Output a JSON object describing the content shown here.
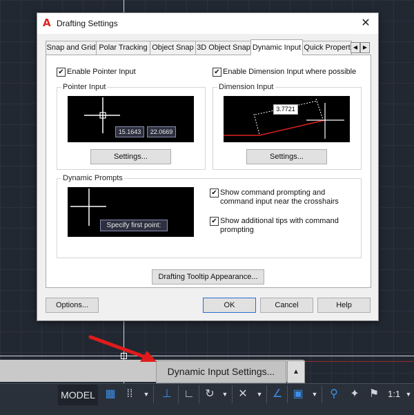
{
  "dialog": {
    "title": "Drafting Settings",
    "close_symbol": "✕",
    "tabs": [
      {
        "label": "Snap and Grid"
      },
      {
        "label": "Polar Tracking"
      },
      {
        "label": "Object Snap"
      },
      {
        "label": "3D Object Snap"
      },
      {
        "label": "Dynamic Input",
        "active": true
      },
      {
        "label": "Quick Propert"
      }
    ],
    "tab_scroll_left": "◀",
    "tab_scroll_right": "▶",
    "enable_pointer_input": {
      "label": "Enable Pointer Input",
      "checked": true
    },
    "enable_dimension_input": {
      "label": "Enable Dimension Input where possible",
      "checked": true
    },
    "pointer_input": {
      "title": "Pointer Input",
      "preview_values": [
        "15.1643",
        "22.0669"
      ],
      "settings_label": "Settings..."
    },
    "dimension_input": {
      "title": "Dimension Input",
      "preview_value": "3.7721",
      "settings_label": "Settings..."
    },
    "dynamic_prompts": {
      "title": "Dynamic Prompts",
      "preview_prompt": "Specify first point:",
      "show_command_prompting": {
        "label": "Show command prompting and command input near the crosshairs",
        "checked": true
      },
      "show_additional_tips": {
        "label": "Show additional tips with command prompting",
        "checked": true
      }
    },
    "tooltip_appearance_label": "Drafting Tooltip Appearance...",
    "options_label": "Options...",
    "ok_label": "OK",
    "cancel_label": "Cancel",
    "help_label": "Help"
  },
  "statusbar": {
    "tooltip_button": "Dynamic Input Settings...",
    "tooltip_caret": "▲",
    "model_label": "MODEL",
    "scale_label": "1:1",
    "icons": [
      "grid-icon",
      "snap-icon",
      "dynamic-input-icon",
      "ortho-icon",
      "polar-icon",
      "isodraft-icon",
      "object-snap-tracking-icon",
      "object-snap-icon",
      "annotation-visibility-icon",
      "autoscale-icon",
      "annotation-scale-icon"
    ]
  },
  "colors": {
    "accent_red": "#e11b1b",
    "dimension_line": "#e02020",
    "active_icon_blue": "#3b8fe8"
  }
}
